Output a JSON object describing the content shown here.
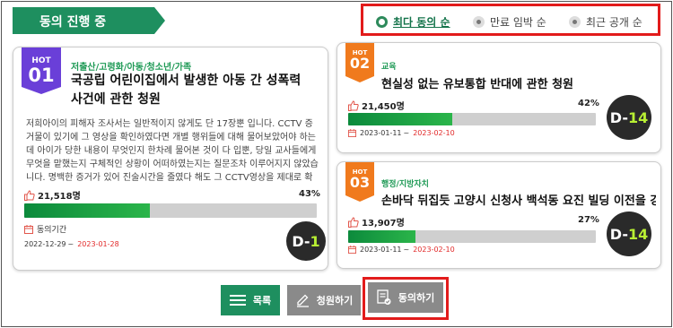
{
  "header": {
    "title": "동의 진행 중"
  },
  "sort": {
    "options": [
      {
        "label": "최다 동의 순",
        "active": true
      },
      {
        "label": "만료 임박 순",
        "active": false
      },
      {
        "label": "최근 공개 순",
        "active": false
      }
    ]
  },
  "cards": [
    {
      "hot_label": "HOT",
      "rank": "01",
      "category": "저출산/고령화/아동/청소년/가족",
      "title": "국공립 어린이집에서 발생한 아동 간 성폭력 사건에 관한 청원",
      "excerpt": "저희아이의 피해자 조사서는 일반적이지 않게도 단 17장뿐 입니다. CCTV 증거물이 있기에 그 영상을 확인하였다면 개별 행위들에 대해 물어보았어야 하는데 아이가 당한 내용이 무엇인지 한차례 물어본 것이 다 입뿐, 당일 교사들에게 무엇을 맡했는지 구체적인 상황이 어떠하였는지는 질문조차 이루어지지 않았습니다. 명백한 증거가 있어 진술시간을 줄였다 해도 그 CCTV영상을 제대로 확인 한",
      "count": "21,518명",
      "percent": "43%",
      "progress": 0.43,
      "period_label": "동의기간",
      "date_start": "2022-12-29",
      "date_sep": "~",
      "date_end": "2023-01-28",
      "dday_prefix": "D-",
      "dday_num": "1"
    },
    {
      "hot_label": "HOT",
      "rank": "02",
      "category": "교육",
      "title": "현실성 없는 유보통합 반대에 관한 청원",
      "count": "21,450명",
      "percent": "42%",
      "progress": 0.42,
      "date_start": "2023-01-11",
      "date_sep": "~",
      "date_end": "2023-02-10",
      "dday_prefix": "D-",
      "dday_num": "14"
    },
    {
      "hot_label": "HOT",
      "rank": "03",
      "category": "행정/지방자치",
      "title": "손바닥 뒤집듯 고양시 신청사 백석동 요진 빌딩 이전을 강",
      "count": "13,907명",
      "percent": "27%",
      "progress": 0.27,
      "date_start": "2023-01-11",
      "date_sep": "~",
      "date_end": "2023-02-10",
      "dday_prefix": "D-",
      "dday_num": "14"
    }
  ],
  "buttons": {
    "list": "목록",
    "petition": "청원하기",
    "agree": "동의하기"
  },
  "colors": {
    "brand_green": "#1e8f5f",
    "badge_purple": "#6a3fd8",
    "badge_orange": "#f07a1d",
    "progress_green": "#22a84a",
    "date_end_red": "#e22a2a",
    "button_gray": "#8a8a8a",
    "highlight_red": "#e21b1b"
  },
  "icons": [
    "thumbs-up-icon",
    "calendar-icon",
    "list-icon",
    "pencil-icon",
    "document-check-icon"
  ]
}
